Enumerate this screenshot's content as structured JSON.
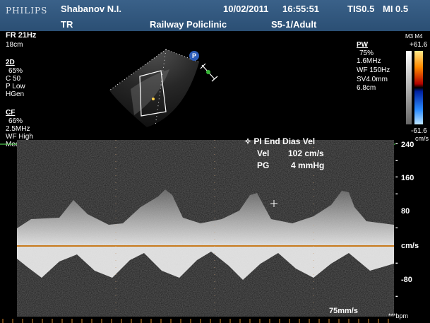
{
  "header": {
    "brand": "PHILIPS",
    "patient": "Shabanov N.I.",
    "date": "10/02/2011",
    "time": "16:55:51",
    "tis": "TIS0.5",
    "mi": "MI 0.5",
    "mode": "TR",
    "institution": "Railway Policlinic",
    "preset": "S5-1/Adult"
  },
  "left_params": {
    "fr": "FR 21Hz",
    "depth": "18cm",
    "twod_title": "2D",
    "twod_lines": [
      "65%",
      "C 50",
      "P Low",
      "HGen"
    ],
    "cf_title": "CF",
    "cf_lines": [
      "66%",
      "2.5MHz",
      "WF High",
      "Med"
    ]
  },
  "right_params": {
    "pw_title": "PW",
    "pw_lines": [
      "75%",
      "1.6MHz",
      "WF 150Hz",
      "SV4.0mm",
      "6.8cm"
    ],
    "map_label": "M3 M4",
    "scale_top": "+61.6",
    "scale_bottom": "-61.6",
    "scale_unit": "cm/s"
  },
  "measurement": {
    "title": "✧ PI End Dias Vel",
    "vel_label": "Vel",
    "vel_value": "102 cm/s",
    "pg_label": "PG",
    "pg_value": "4 mmHg"
  },
  "velocity_scale": {
    "ticks": [
      "240",
      "160",
      "80",
      "cm/s",
      "-80"
    ],
    "dashes": [
      "-",
      "-",
      "-",
      "-",
      "-"
    ]
  },
  "footer": {
    "sweep": "75mm/s",
    "bpm": "***bpm"
  },
  "colors": {
    "header_bg": "#2f5680",
    "baseline": "#c87a1c",
    "ecg": "#4fc84f"
  }
}
